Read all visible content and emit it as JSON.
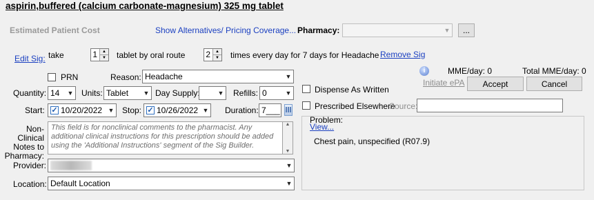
{
  "title": "aspirin,buffered (calcium carbonate-magnesium) 325 mg tablet",
  "cost_label": "Estimated Patient Cost",
  "show_alternatives": "Show Alternatives/ Pricing Coverage...",
  "pharmacy": {
    "label": "Pharmacy:",
    "value": "",
    "more_button": "..."
  },
  "sig": {
    "edit_link": "Edit Sig:",
    "take": "take",
    "dose": "1",
    "route_text": "tablet by oral route",
    "times": "2",
    "freq_text": "times every day for 7 days  for Headache",
    "remove_link": "Remove Sig"
  },
  "prn": {
    "label": "PRN",
    "checked": false
  },
  "reason": {
    "label": "Reason:",
    "value": "Headache"
  },
  "quantity": {
    "label": "Quantity:",
    "value": "14"
  },
  "units": {
    "label": "Units:",
    "value": "Tablet"
  },
  "day_supply": {
    "label": "Day Supply:",
    "value": ""
  },
  "refills": {
    "label": "Refills:",
    "value": "0"
  },
  "start": {
    "label": "Start:",
    "value": "10/20/2022",
    "checked": true
  },
  "stop": {
    "label": "Stop:",
    "value": "10/26/2022",
    "checked": true
  },
  "duration": {
    "label": "Duration:",
    "value": "7___"
  },
  "notes": {
    "label": "Non-Clinical Notes to Pharmacy:",
    "placeholder": "This field is for nonclinical comments to the pharmacist. Any additional clinical instructions for this prescription should be added using the 'Additional Instructions' segment of the Sig Builder."
  },
  "provider": {
    "label": "Provider:",
    "value": ""
  },
  "location": {
    "label": "Location:",
    "value": "Default Location"
  },
  "mme_day": "MME/day: 0",
  "total_mme_day": "Total MME/day: 0",
  "initiate_epa": "Initiate ePA",
  "accept_button": "Accept",
  "cancel_button": "Cancel",
  "dispense_as_written": {
    "label": "Dispense As Written",
    "checked": false
  },
  "prescribed_elsewhere": {
    "label": "Prescribed Elsewhere",
    "checked": false
  },
  "source": {
    "label": "Source:",
    "value": ""
  },
  "problem": {
    "label": "Problem:",
    "view_link": "View...",
    "value": "Chest pain, unspecified (R07.9)"
  },
  "colors": {
    "link": "#1a3fc0",
    "background": "#f0f0f0",
    "muted": "#8c8c8c"
  }
}
